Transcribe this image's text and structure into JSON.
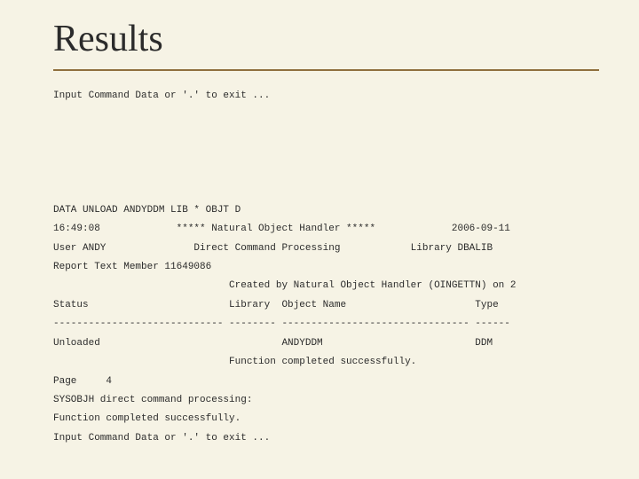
{
  "slide": {
    "title": "Results",
    "lines": {
      "l0": "Input Command Data or '.' to exit ...",
      "l1": "",
      "l2": "",
      "l3": "",
      "l4": "",
      "l5": "",
      "l6": "DATA UNLOAD ANDYDDM LIB * OBJT D",
      "l7": "16:49:08             ***** Natural Object Handler *****             2006-09-11",
      "l8": "User ANDY               Direct Command Processing            Library DBALIB",
      "l9": "Report Text Member 11649086",
      "l10": "                              Created by Natural Object Handler (OINGETTN) on 2",
      "l11": "Status                        Library  Object Name                      Type",
      "l12": "----------------------------- -------- -------------------------------- ------",
      "l13": "Unloaded                               ANDYDDM                          DDM",
      "l14": "                              Function completed successfully.",
      "l15": "Page     4",
      "l16": "SYSOBJH direct command processing:",
      "l17": "Function completed successfully.",
      "l18": "Input Command Data or '.' to exit ..."
    }
  }
}
